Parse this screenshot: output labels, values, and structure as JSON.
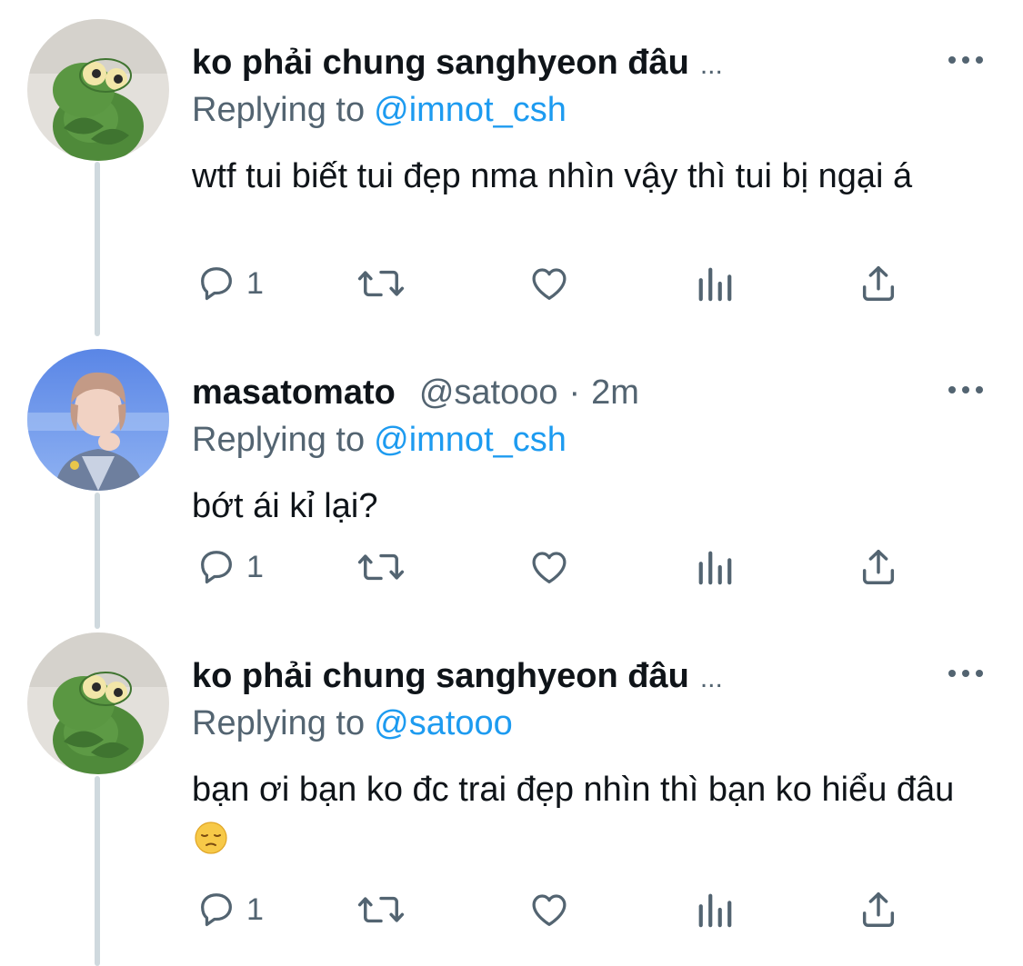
{
  "tweets": [
    {
      "display_name": "ko phải chung sanghyeon đâu",
      "name_ellipsis": "...",
      "handle": "",
      "time_separator": "",
      "time": "",
      "replying_prefix": "Replying to",
      "replying_handle": "@imnot_csh",
      "text": "wtf tui biết tui đẹp nma nhìn vậy thì tui bị ngại á",
      "reply_count": "1",
      "avatar": "frog-plush-avatar"
    },
    {
      "display_name": "masatomato",
      "name_ellipsis": "",
      "handle": "@satooo",
      "time_separator": "·",
      "time": "2m",
      "replying_prefix": "Replying to",
      "replying_handle": "@imnot_csh",
      "text": "bớt ái kỉ lại?",
      "reply_count": "1",
      "avatar": "person-photo-avatar"
    },
    {
      "display_name": "ko phải chung sanghyeon đâu",
      "name_ellipsis": "...",
      "handle": "",
      "time_separator": "",
      "time": "",
      "replying_prefix": "Replying to",
      "replying_handle": "@satooo",
      "text": "bạn ơi bạn ko đc trai đẹp nhìn thì bạn ko hiểu đâu",
      "text_emoji": "pensive-face-emoji",
      "reply_count": "1",
      "avatar": "frog-plush-avatar"
    }
  ],
  "icons": {
    "reply": "reply-icon",
    "retweet": "retweet-icon",
    "like": "heart-icon",
    "views": "views-icon",
    "share": "share-icon",
    "more": "more-options-icon"
  },
  "colors": {
    "text": "#0f1419",
    "secondary": "#536471",
    "accent": "#1d9bf0",
    "thread_line": "#cfd9de"
  }
}
